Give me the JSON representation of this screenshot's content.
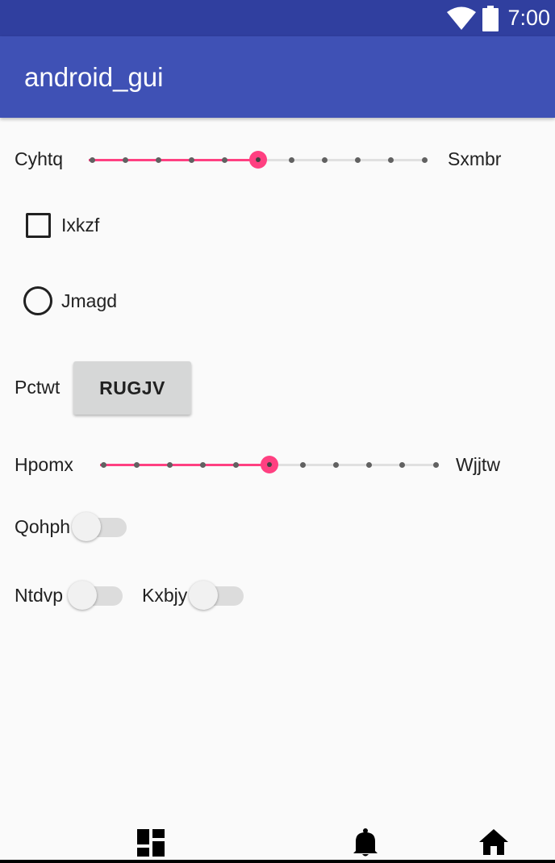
{
  "status_bar": {
    "time": "7:00",
    "icons": [
      "wifi-icon",
      "battery-icon"
    ]
  },
  "app_bar": {
    "title": "android_gui"
  },
  "controls": {
    "slider1": {
      "left_label": "Cyhtq",
      "right_label": "Sxmbr",
      "value": 5,
      "max": 10
    },
    "checkbox": {
      "label": "Ixkzf",
      "checked": false
    },
    "radio": {
      "label": "Jmagd",
      "selected": false
    },
    "button_row": {
      "label": "Pctwt",
      "button_text": "RUGJV"
    },
    "slider2": {
      "left_label": "Hpomx",
      "right_label": "Wjjtw",
      "value": 5,
      "max": 10
    },
    "switch1": {
      "label": "Qohph",
      "on": false
    },
    "switch2": {
      "label": "Ntdvp",
      "on": false
    },
    "switch3": {
      "label": "Kxbjy",
      "on": false
    }
  },
  "bottom_nav": {
    "items": [
      "dashboard-icon",
      "notifications-icon",
      "home-icon"
    ]
  },
  "colors": {
    "status_bar": "#303f9f",
    "app_bar": "#3f51b5",
    "accent": "#ff4081",
    "background": "#fafafa"
  }
}
